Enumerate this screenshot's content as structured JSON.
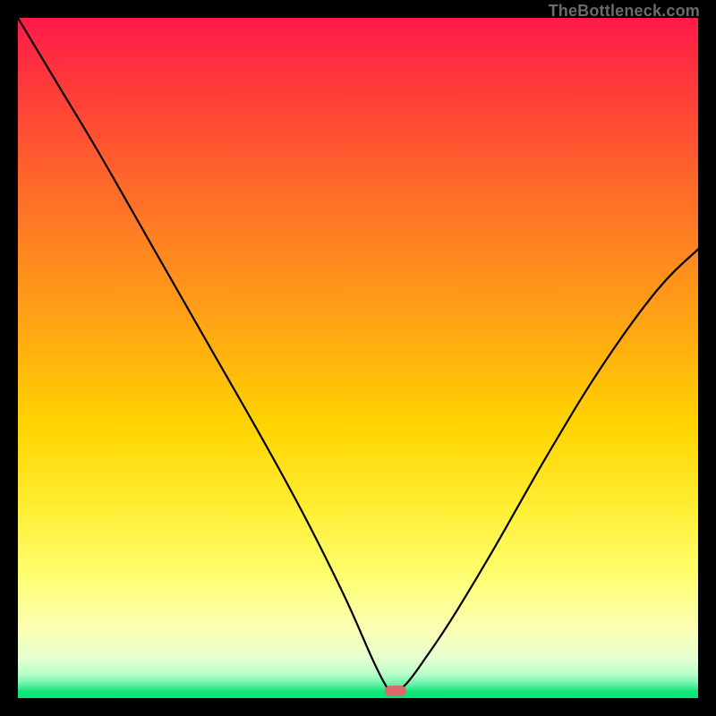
{
  "watermark": "TheBottleneck.com",
  "marker": {
    "x_percent": 55.5,
    "y_percent": 99.0,
    "color": "#d96b6b"
  },
  "chart_data": {
    "type": "line",
    "title": "",
    "xlabel": "",
    "ylabel": "",
    "xlim": [
      0,
      100
    ],
    "ylim": [
      0,
      100
    ],
    "grid": false,
    "legend": false,
    "note": "Bottleneck V-curve over green–red gradient background. Minimum at x≈55.",
    "series": [
      {
        "name": "bottleneck-curve",
        "x": [
          0,
          6,
          12,
          20,
          28,
          36,
          42,
          48,
          52,
          54,
          55,
          57,
          60,
          64,
          70,
          78,
          86,
          94,
          100
        ],
        "values": [
          100,
          90,
          80,
          66,
          52,
          38,
          27,
          15,
          6,
          2,
          1,
          2,
          6,
          12,
          22,
          36,
          49,
          60,
          66
        ]
      }
    ]
  }
}
